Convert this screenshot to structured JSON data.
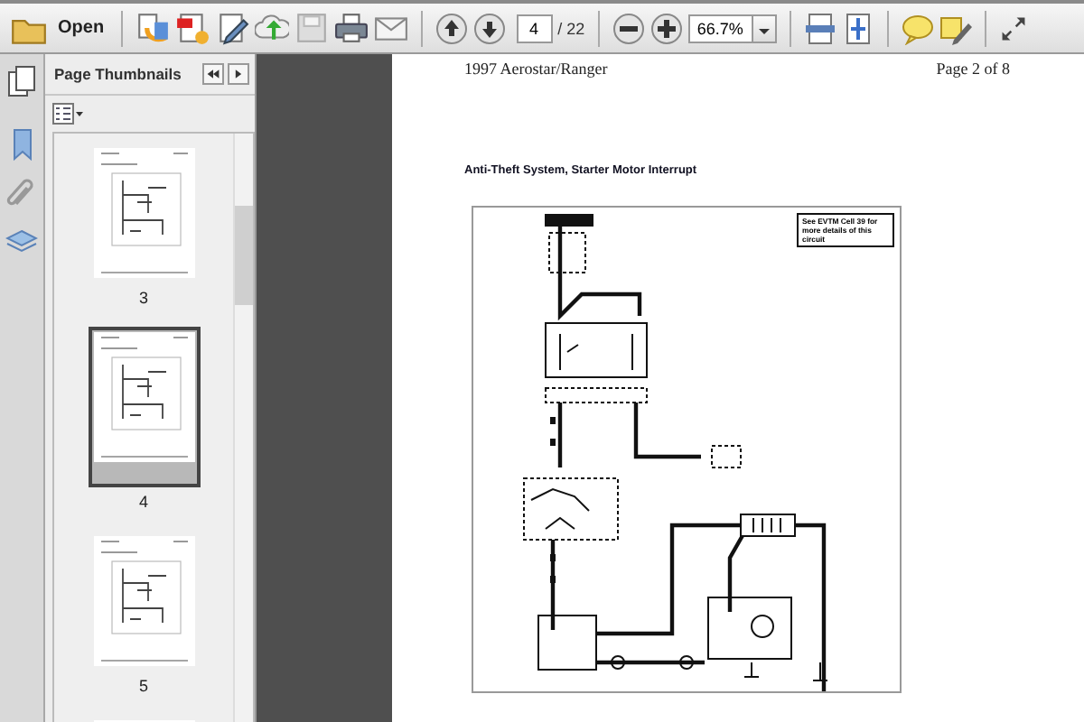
{
  "toolbar": {
    "open_label": "Open",
    "page_field": {
      "value": "4"
    },
    "page_count": "/ 22",
    "zoom_field": {
      "value": "66.7%"
    }
  },
  "sidebar": {
    "title": "Page Thumbnails",
    "thumbnails": [
      {
        "label": "3",
        "selected": false
      },
      {
        "label": "4",
        "selected": true
      },
      {
        "label": "5",
        "selected": false
      },
      {
        "selected": false
      }
    ]
  },
  "document": {
    "header_left": "1997 Aerostar/Ranger",
    "header_right": "Page 2 of 8",
    "title": "Anti-Theft System, Starter Motor Interrupt",
    "diagram_note": "See EVTM Cell 39 for more details of this circuit"
  }
}
